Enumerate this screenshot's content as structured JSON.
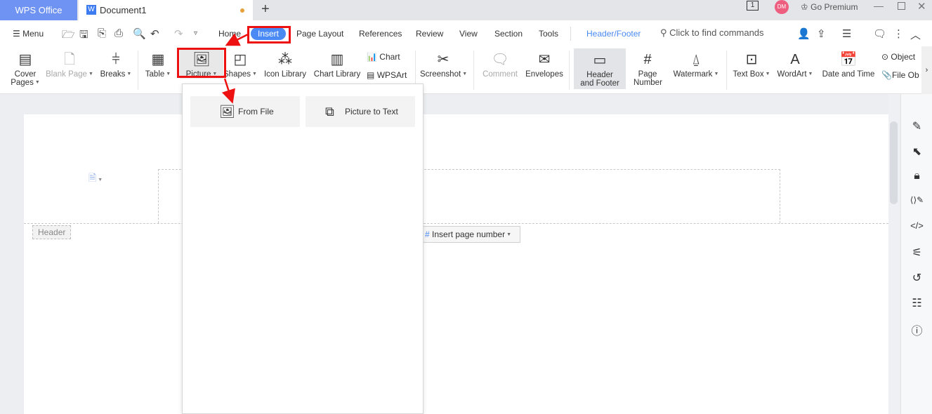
{
  "tabs": {
    "app": "WPS Office",
    "document": "Document1",
    "new_tab": "+"
  },
  "titlebar": {
    "page_count": "1",
    "avatar": "DM",
    "premium": "Go Premium"
  },
  "menubar": {
    "menu": "Menu",
    "items": [
      "Home",
      "Insert",
      "Page Layout",
      "References",
      "Review",
      "View",
      "Section",
      "Tools"
    ],
    "context_tab": "Header/Footer",
    "search_placeholder": "Click to find commands",
    "active": "Insert"
  },
  "ribbon": {
    "cover_pages": "Cover Pages",
    "blank_page": "Blank Page",
    "breaks": "Breaks",
    "table": "Table",
    "picture": "Picture",
    "shapes": "Shapes",
    "icon_library": "Icon Library",
    "chart_library": "Chart Library",
    "chart": "Chart",
    "wpsart": "WPSArt",
    "screenshot": "Screenshot",
    "comment": "Comment",
    "envelopes": "Envelopes",
    "header_footer": "Header and Footer",
    "page_number": "Page Number",
    "watermark": "Watermark",
    "text_box": "Text Box",
    "wordart": "WordArt",
    "date_time": "Date and Time",
    "object": "Object",
    "file_object": "File Ob"
  },
  "picture_menu": {
    "from_file": "From File",
    "picture_to_text": "Picture to Text"
  },
  "document": {
    "header_label": "Header",
    "insert_page_number": "Insert page number"
  },
  "colors": {
    "accent": "#4a8af4",
    "annotation": "#ee1111",
    "wps_tab": "#6e93f3"
  }
}
